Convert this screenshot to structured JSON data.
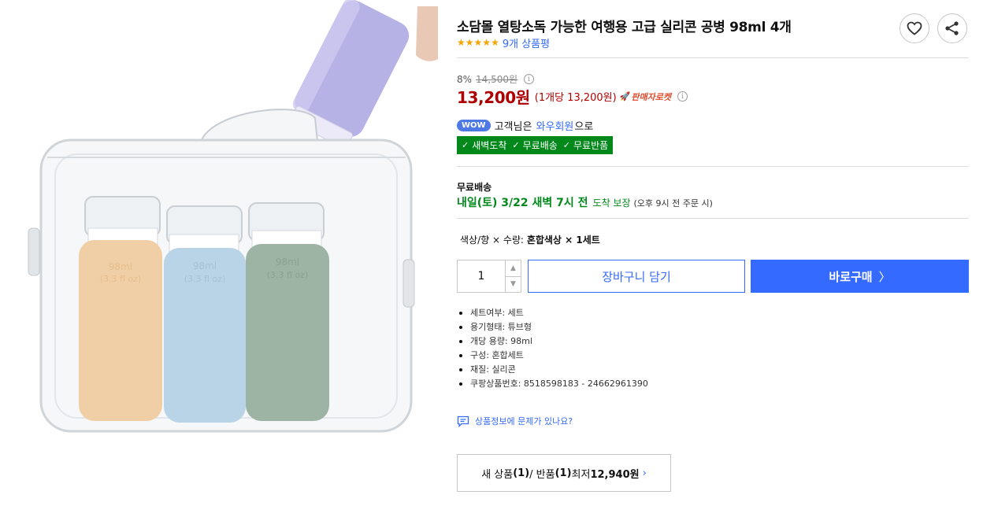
{
  "product": {
    "title": "소담몰 열탕소독 가능한 여행용 고급 실리콘 공병 98ml 4개",
    "rating_stars": 5,
    "review_link": "9개 상품평",
    "image_alt": "product-image",
    "bottle_print_1": "98ml",
    "bottle_print_2": "(3.3 fl oz)"
  },
  "actions": {
    "wishlist_icon": "heart-icon",
    "share_icon": "share-icon"
  },
  "price": {
    "discount": "8%",
    "original": "14,500원",
    "sale": "13,200원",
    "unit": "(1개당 13,200원)",
    "rocket_badge": "판매자로켓",
    "info_glyph": "i"
  },
  "wow": {
    "badge": "WOW",
    "text_before": "고객님은",
    "link": "와우회원",
    "text_after": "으로"
  },
  "benefits": [
    "새벽도착",
    "무료배송",
    "무료반품"
  ],
  "shipping": {
    "label": "무료배송",
    "date": "내일(토) 3/22 새벽 7시 전",
    "guarantee": "도착 보장",
    "condition": "(오후 9시 전 주문 시)"
  },
  "option": {
    "label": "색상/향 × 수량:",
    "value": "혼합색상 × 1세트"
  },
  "quantity": {
    "value": "1",
    "up": "▲",
    "down": "▼"
  },
  "buttons": {
    "cart": "장바구니 담기",
    "buy": "바로구매",
    "buy_chevron": "〉"
  },
  "specs": [
    "세트여부: 세트",
    "용기형태: 튜브형",
    "개당 용량: 98ml",
    "구성: 혼합세트",
    "재질: 실리콘",
    "쿠팡상품번호: 8518598183 - 24662961390"
  ],
  "report": {
    "text": "상품정보에 문제가 있나요?",
    "icon": "message-icon"
  },
  "other_sellers": {
    "prefix": "새 상품 ",
    "new_count": "(1)",
    "separator": " / 반품 ",
    "return_count": "(1)",
    "lowest_label": " 최저 ",
    "lowest_price": "12,940원",
    "chevron": "›"
  },
  "colors": {
    "accent_blue": "#346aff",
    "price_red": "#ae0000",
    "rocket_green": "#00891a",
    "wow_blue": "#4e78e5"
  }
}
